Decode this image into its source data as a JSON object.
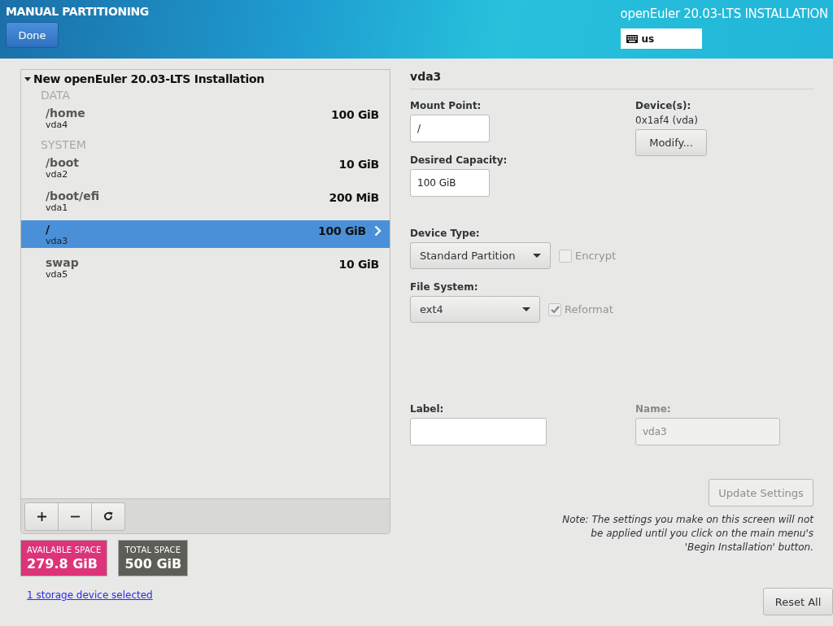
{
  "header": {
    "title": "MANUAL PARTITIONING",
    "done_button": "Done",
    "product": "openEuler 20.03-LTS INSTALLATION",
    "keyboard_layout": "us"
  },
  "tree": {
    "root": "New openEuler 20.03-LTS Installation",
    "expanded": true,
    "groups": [
      {
        "name": "DATA",
        "items": [
          {
            "mount": "/home",
            "device": "vda4",
            "size": "100 GiB",
            "selected": false
          }
        ]
      },
      {
        "name": "SYSTEM",
        "items": [
          {
            "mount": "/boot",
            "device": "vda2",
            "size": "10 GiB",
            "selected": false
          },
          {
            "mount": "/boot/efi",
            "device": "vda1",
            "size": "200 MiB",
            "selected": false
          },
          {
            "mount": "/",
            "device": "vda3",
            "size": "100 GiB",
            "selected": true
          },
          {
            "mount": "swap",
            "device": "vda5",
            "size": "10 GiB",
            "selected": false
          }
        ]
      }
    ]
  },
  "space": [
    {
      "label": "AVAILABLE SPACE",
      "value": "279.8 GiB",
      "color": "#dd3479"
    },
    {
      "label": "TOTAL SPACE",
      "value": "500 GiB",
      "color": "#5d5e57"
    }
  ],
  "storage_link": "1 storage device selected",
  "details": {
    "title": "vda3",
    "mount_point": {
      "label": "Mount Point:",
      "value": "/"
    },
    "desired_capacity": {
      "label": "Desired Capacity:",
      "value": "100 GiB"
    },
    "devices": {
      "label": "Device(s):",
      "value": "0x1af4 (vda)",
      "button": "Modify..."
    },
    "device_type": {
      "label": "Device Type:",
      "value": "Standard Partition"
    },
    "encrypt": {
      "label": "Encrypt",
      "checked": false,
      "disabled": true
    },
    "file_system": {
      "label": "File System:",
      "value": "ext4"
    },
    "reformat": {
      "label": "Reformat",
      "checked": true,
      "disabled": true
    },
    "label_field": {
      "label": "Label:"
    },
    "name_field": {
      "label": "Name:",
      "value": "vda3",
      "disabled": true
    },
    "update_button": {
      "label": "Update Settings",
      "disabled": true
    },
    "note": "*Note:  The settings you make on this screen will not be applied until you click on the main menu's 'Begin Installation' button.*"
  },
  "reset_button": "Reset All"
}
